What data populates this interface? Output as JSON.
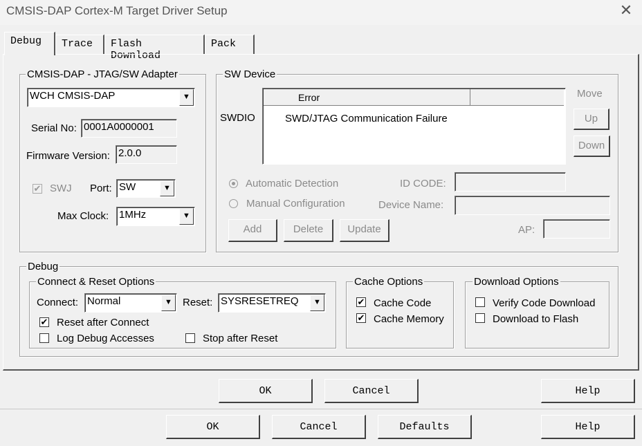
{
  "window": {
    "title": "CMSIS-DAP Cortex-M Target Driver Setup"
  },
  "tabs": [
    "Debug",
    "Trace",
    "Flash Download",
    "Pack"
  ],
  "adapter": {
    "legend": "CMSIS-DAP - JTAG/SW Adapter",
    "selected": "WCH CMSIS-DAP",
    "serial_label": "Serial No:",
    "serial_value": "0001A0000001",
    "firmware_label": "Firmware Version:",
    "firmware_value": "2.0.0",
    "swj_label": "SWJ",
    "swj_checked": true,
    "port_label": "Port:",
    "port_value": "SW",
    "maxclock_label": "Max Clock:",
    "maxclock_value": "1MHz"
  },
  "sw_device": {
    "legend": "SW Device",
    "row_label": "SWDIO",
    "column_header": "Error",
    "row_value": "SWD/JTAG Communication Failure",
    "move_label": "Move",
    "up_label": "Up",
    "down_label": "Down",
    "auto_detect_label": "Automatic Detection",
    "manual_config_label": "Manual Configuration",
    "id_code_label": "ID CODE:",
    "device_name_label": "Device Name:",
    "ap_label": "AP:",
    "add_label": "Add",
    "delete_label": "Delete",
    "update_label": "Update"
  },
  "debug": {
    "legend": "Debug",
    "connect_reset": {
      "legend": "Connect & Reset Options",
      "connect_label": "Connect:",
      "connect_value": "Normal",
      "reset_label": "Reset:",
      "reset_value": "SYSRESETREQ",
      "reset_after_connect": {
        "label": "Reset after Connect",
        "checked": true
      },
      "log_debug_accesses": {
        "label": "Log Debug Accesses",
        "checked": false
      },
      "stop_after_reset": {
        "label": "Stop after Reset",
        "checked": false
      }
    },
    "cache": {
      "legend": "Cache Options",
      "cache_code": {
        "label": "Cache Code",
        "checked": true
      },
      "cache_memory": {
        "label": "Cache Memory",
        "checked": true
      }
    },
    "download": {
      "legend": "Download Options",
      "verify": {
        "label": "Verify Code Download",
        "checked": false
      },
      "to_flash": {
        "label": "Download to Flash",
        "checked": false
      }
    }
  },
  "inner_buttons": {
    "ok": "OK",
    "cancel": "Cancel",
    "help": "Help"
  },
  "outer_buttons": {
    "ok": "OK",
    "cancel": "Cancel",
    "defaults": "Defaults",
    "help": "Help"
  }
}
